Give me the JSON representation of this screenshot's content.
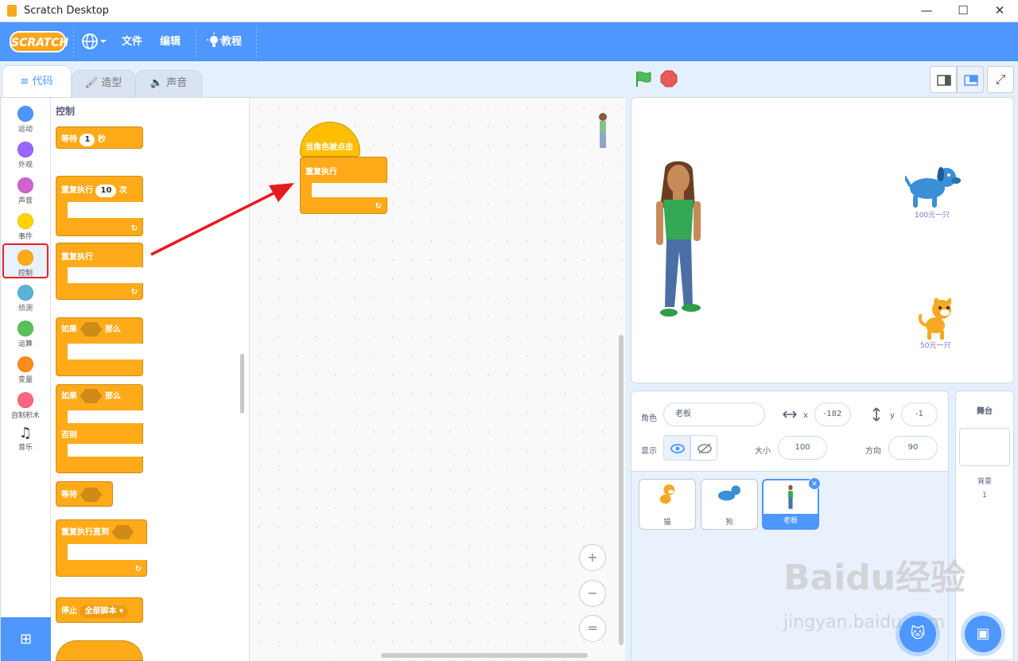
{
  "window": {
    "title": "Scratch Desktop",
    "min": "—",
    "max": "☐",
    "close": "✕"
  },
  "menubar": {
    "logo": "SCRATCH",
    "language_icon": "globe-icon",
    "file": "文件",
    "edit": "编辑",
    "tutorials": "教程"
  },
  "tabs": {
    "code": "代码",
    "costumes": "造型",
    "sounds": "声音"
  },
  "categories": [
    {
      "label": "运动",
      "color": "#4c97ff"
    },
    {
      "label": "外观",
      "color": "#9966ff"
    },
    {
      "label": "声音",
      "color": "#cf63cf"
    },
    {
      "label": "事件",
      "color": "#ffd500"
    },
    {
      "label": "控制",
      "color": "#ffab19"
    },
    {
      "label": "侦测",
      "color": "#5cb1d6"
    },
    {
      "label": "运算",
      "color": "#59c059"
    },
    {
      "label": "变量",
      "color": "#ff8c1a"
    },
    {
      "label": "自制积木",
      "color": "#ff6680"
    },
    {
      "label": "音乐",
      "color": "#0fbd8c"
    }
  ],
  "palette": {
    "title": "控制",
    "wait": "等待",
    "wait_value": "1",
    "wait_unit": "秒",
    "repeat": "重复执行",
    "repeat_value": "10",
    "repeat_unit": "次",
    "forever": "重复执行",
    "if": "如果",
    "then": "那么",
    "if2": "如果",
    "then2": "那么",
    "else": "否则",
    "wait_until": "等待",
    "repeat_until": "重复执行直到",
    "stop": "停止",
    "stop_option": "全部脚本 ▾"
  },
  "script": {
    "hat": "当角色被点击",
    "forever": "重复执行"
  },
  "zoom": {
    "in": "+",
    "out": "−",
    "reset": "="
  },
  "stage": {
    "dog_label": "100元一只",
    "cat_label": "50元一只"
  },
  "sprite_info": {
    "sprite_label": "角色",
    "sprite_name": "老板",
    "x_label": "x",
    "x_value": "-182",
    "y_label": "y",
    "y_value": "-1",
    "show_label": "显示",
    "size_label": "大小",
    "size_value": "100",
    "direction_label": "方向",
    "direction_value": "90"
  },
  "sprites": [
    {
      "name": "猫",
      "selected": false
    },
    {
      "name": "狗",
      "selected": false
    },
    {
      "name": "老板",
      "selected": true
    }
  ],
  "stage_panel": {
    "title": "舞台",
    "backdrops_label": "背景",
    "backdrops_count": "1"
  },
  "watermark": {
    "brand": "Baidu经验",
    "url": "jingyan.baidu.com"
  }
}
